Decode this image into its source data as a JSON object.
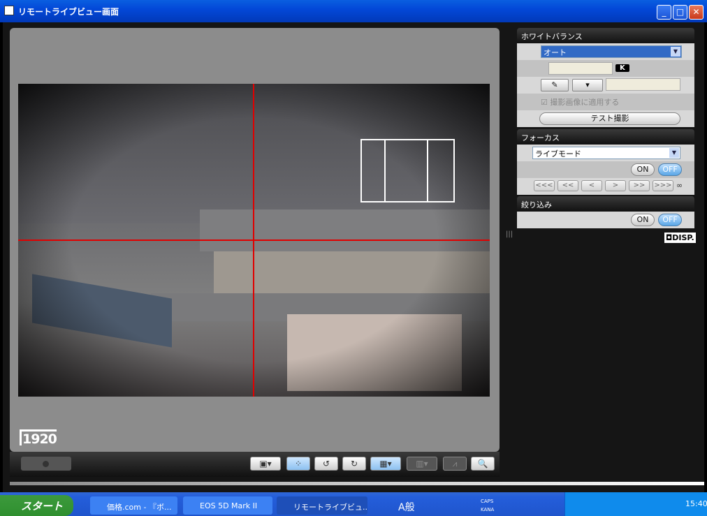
{
  "window": {
    "title": "リモートライブビュー画面",
    "minimize": "_",
    "maximize": "□",
    "close": "✕"
  },
  "view": {
    "resolution": "1920"
  },
  "toolbar": {
    "buttons": [
      "overlay-compose",
      "af-frame",
      "rotate-left",
      "rotate-right",
      "grid",
      "aspect",
      "histogram",
      "zoom"
    ]
  },
  "white_balance": {
    "header": "ホワイトバランス",
    "mode": "オート",
    "kelvin_value": "",
    "kelvin_unit": "K",
    "apply_label": "撮影画像に適用する",
    "test_shot": "テスト撮影"
  },
  "focus": {
    "header": "フォーカス",
    "mode": "ライブモード",
    "on": "ON",
    "off": "OFF",
    "steps": [
      "<<<",
      "<<",
      "<",
      ">",
      ">>",
      ">>>"
    ],
    "infinity": "∞"
  },
  "dof": {
    "header": "絞り込み",
    "on": "ON",
    "off": "OFF"
  },
  "disp": "DISP.",
  "taskbar": {
    "start": "スタート",
    "tasks": [
      "価格.com - 『ボ...",
      "EOS 5D Mark II",
      "リモートライブビュ..."
    ],
    "ime": "A般",
    "caps": "CAPS",
    "kana": "KANA",
    "clock": "15:40"
  },
  "colors": {
    "guide_line": "#e00000",
    "title_bar": "#0348d8"
  }
}
